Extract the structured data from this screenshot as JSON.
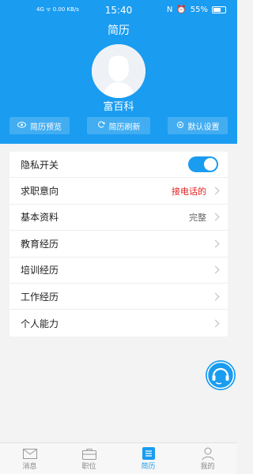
{
  "status_bar": {
    "left": "4G ᯤ 0.00 KB/s",
    "time": "15:40",
    "battery": "55%"
  },
  "header": {
    "title": "简历",
    "username": "富百科",
    "actions": [
      {
        "label": "简历预览",
        "icon": "eye-icon"
      },
      {
        "label": "简历刷新",
        "icon": "refresh-icon"
      },
      {
        "label": "默认设置",
        "icon": "settings-icon"
      }
    ]
  },
  "rows": [
    {
      "label": "隐私开关",
      "type": "toggle",
      "on": true
    },
    {
      "label": "求职意向",
      "value": "接电话的"
    },
    {
      "label": "基本资料",
      "value": "完整"
    },
    {
      "label": "教育经历",
      "value": ""
    },
    {
      "label": "培训经历",
      "value": ""
    },
    {
      "label": "工作经历",
      "value": ""
    },
    {
      "label": "个人能力",
      "value": ""
    }
  ],
  "tabs": [
    {
      "label": "消息",
      "icon": "mail-icon"
    },
    {
      "label": "职位",
      "icon": "briefcase-icon"
    },
    {
      "label": "简历",
      "icon": "resume-icon"
    },
    {
      "label": "我的",
      "icon": "user-icon"
    }
  ],
  "colors": {
    "primary": "#1a9cf0",
    "accent_red": "#e02020",
    "background": "#f3f3f3"
  }
}
